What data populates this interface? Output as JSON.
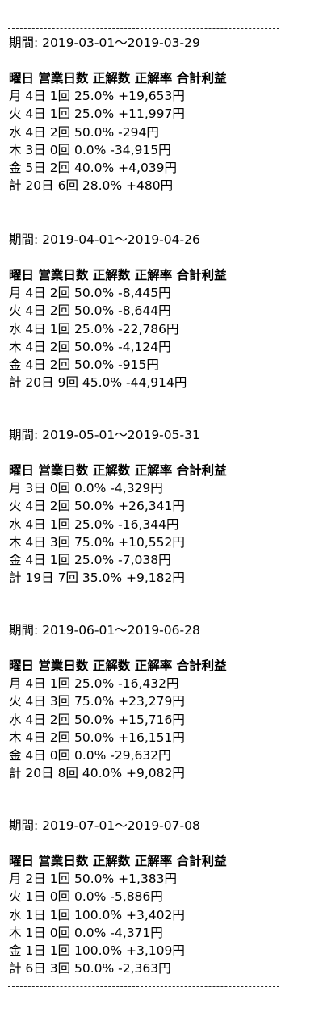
{
  "divider": "--------------------------------------------------",
  "header": "曜日 営業日数 正解数 正解率 合計利益",
  "periods": [
    {
      "label": "期間: 2019-03-01～2019-03-29",
      "rows": [
        "月 4日 1回 25.0% +19,653円",
        "火 4日 1回 25.0% +11,997円",
        "水 4日 2回 50.0% -294円",
        "木 3日 0回 0.0% -34,915円",
        "金 5日 2回 40.0% +4,039円",
        "計 20日 6回 28.0% +480円"
      ]
    },
    {
      "label": "期間: 2019-04-01～2019-04-26",
      "rows": [
        "月 4日 2回 50.0% -8,445円",
        "火 4日 2回 50.0% -8,644円",
        "水 4日 1回 25.0% -22,786円",
        "木 4日 2回 50.0% -4,124円",
        "金 4日 2回 50.0% -915円",
        "計 20日 9回 45.0% -44,914円"
      ]
    },
    {
      "label": "期間: 2019-05-01～2019-05-31",
      "rows": [
        "月 3日 0回 0.0% -4,329円",
        "火 4日 2回 50.0% +26,341円",
        "水 4日 1回 25.0% -16,344円",
        "木 4日 3回 75.0% +10,552円",
        "金 4日 1回 25.0% -7,038円",
        "計 19日 7回 35.0% +9,182円"
      ]
    },
    {
      "label": "期間: 2019-06-01～2019-06-28",
      "rows": [
        "月 4日 1回 25.0% -16,432円",
        "火 4日 3回 75.0% +23,279円",
        "水 4日 2回 50.0% +15,716円",
        "木 4日 2回 50.0% +16,151円",
        "金 4日 0回 0.0% -29,632円",
        "計 20日 8回 40.0% +9,082円"
      ]
    },
    {
      "label": "期間: 2019-07-01～2019-07-08",
      "rows": [
        "月 2日 1回 50.0% +1,383円",
        "火 1日 0回 0.0% -5,886円",
        "水 1日 1回 100.0% +3,402円",
        "木 1日 0回 0.0% -4,371円",
        "金 1日 1回 100.0% +3,109円",
        "計 6日 3回 50.0% -2,363円"
      ]
    }
  ]
}
